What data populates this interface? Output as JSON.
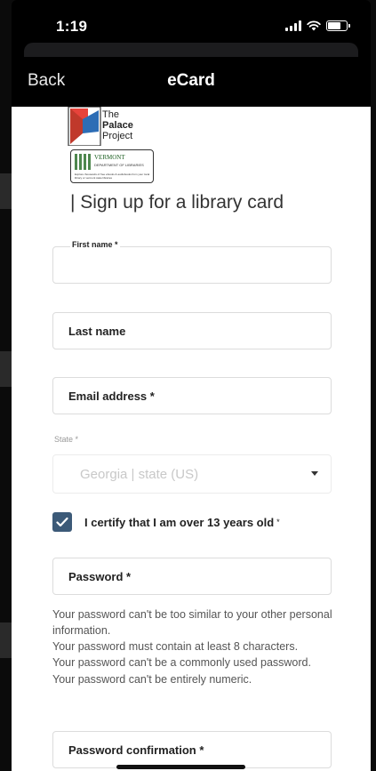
{
  "status_bar": {
    "time": "1:19",
    "icons": [
      "signal-icon",
      "wifi-icon",
      "battery-icon"
    ]
  },
  "nav": {
    "back_label": "Back",
    "title": "eCard"
  },
  "logo": {
    "line1": "The",
    "line2": "Palace",
    "line3": "Project",
    "partner": "VERMONT",
    "partner_sub": "DEPARTMENT OF LIBRARIES",
    "fine_print": "Explore thousands of free ebooks & audiobooks from your local library or vermont state libraries"
  },
  "form": {
    "heading": "| Sign up for a library card",
    "first_name_label": "First name *",
    "last_name_label": "Last name",
    "email_label": "Email address *",
    "state_label": "State *",
    "state_value": "Georgia | state (US)",
    "certify_label": "I certify that I am over 13 years old",
    "certify_required": "*",
    "certify_checked": true,
    "password_label": "Password *",
    "password_help": [
      "Your password can't be too similar to your other personal information.",
      "Your password must contain at least 8 characters.",
      "Your password can't be a commonly used password.",
      "Your password can't be entirely numeric."
    ],
    "password_confirm_label": "Password confirmation *"
  },
  "colors": {
    "checkbox": "#3c5a78",
    "nav_bg": "#000000",
    "content_bg": "#ffffff"
  }
}
